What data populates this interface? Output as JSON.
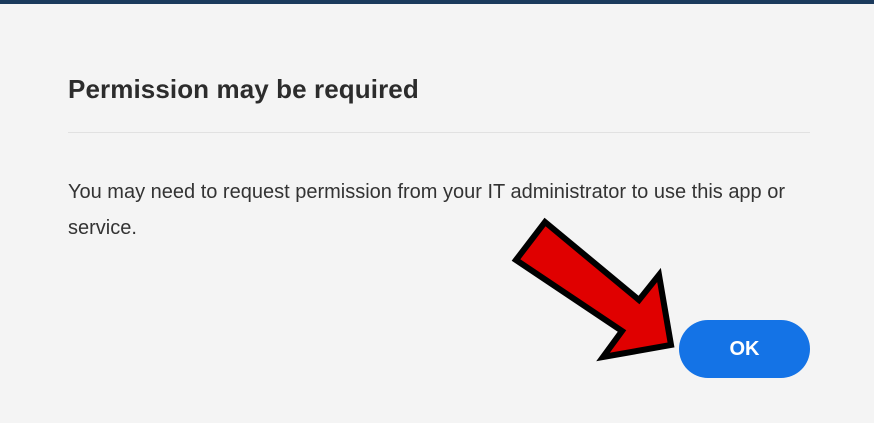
{
  "dialog": {
    "title": "Permission may be required",
    "message": "You may need to request permission from your IT administrator to use this app or service.",
    "ok_label": "OK"
  },
  "colors": {
    "background": "#f4f4f4",
    "top_bar": "#1b3a5c",
    "primary_button": "#1473e6",
    "annotation_arrow": "#e00000",
    "title_text": "#2c2c2c",
    "body_text": "#333333"
  },
  "icons": {
    "annotation": "red-arrow-icon"
  }
}
